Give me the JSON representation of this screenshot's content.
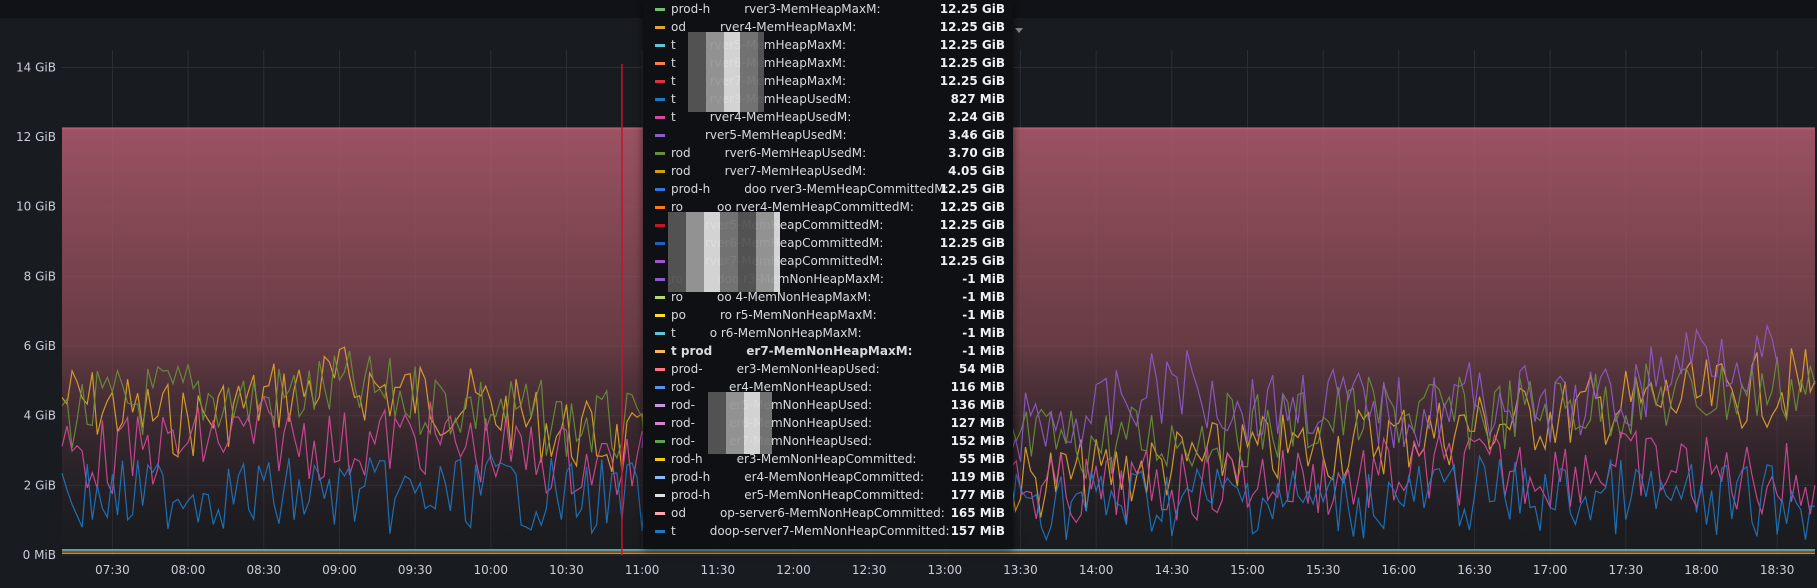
{
  "colors": {
    "background": "#181b1f",
    "grid": "#2c2f36",
    "heap_band": "#b35c6e",
    "hover_line": "#c4162a",
    "series_yellow": "#e0a52e",
    "series_green": "#6a8f3a",
    "series_pink": "#d44a9a",
    "series_blue": "#1f78c1",
    "series_purple": "#8f5bc8"
  },
  "icons": {
    "menu": "chevron-down-icon"
  },
  "chart_data": {
    "type": "line",
    "y_ticks": [
      "14 GiB",
      "12 GiB",
      "10 GiB",
      "8 GiB",
      "6 GiB",
      "4 GiB",
      "2 GiB",
      "0 MiB"
    ],
    "y_tick_values": [
      14,
      12,
      10,
      8,
      6,
      4,
      2,
      0
    ],
    "ylim": [
      0,
      14.5
    ],
    "x_ticks": [
      "07:30",
      "08:00",
      "08:30",
      "09:00",
      "09:30",
      "10:00",
      "10:30",
      "11:00",
      "11:30",
      "12:00",
      "12:30",
      "13:00",
      "13:30",
      "14:00",
      "14:30",
      "15:00",
      "15:30",
      "16:00",
      "16:30",
      "17:00",
      "17:30",
      "18:00",
      "18:30"
    ],
    "grid": true,
    "hover_time": "10:52",
    "series": [
      {
        "color": "#b35c6e",
        "fill": true,
        "x": [
          "07:10",
          "18:45"
        ],
        "values": [
          12.25,
          12.25
        ]
      },
      {
        "color": "#e0a52e",
        "x": [
          "07:10",
          "07:30",
          "08:00",
          "08:30",
          "09:00",
          "09:30",
          "10:00",
          "10:30",
          "11:00",
          "13:30",
          "14:00",
          "14:30",
          "15:00",
          "15:30",
          "16:00",
          "16:30",
          "17:00",
          "17:30",
          "18:00",
          "18:30",
          "18:45"
        ],
        "values": [
          4.5,
          4.2,
          3.8,
          4.5,
          5.0,
          4.6,
          4.2,
          3.5,
          3.0,
          2.1,
          2.3,
          2.6,
          2.9,
          3.1,
          3.4,
          3.7,
          4.0,
          4.3,
          4.5,
          4.8,
          5.0
        ]
      },
      {
        "color": "#6a8f3a",
        "x": [
          "07:10",
          "07:30",
          "08:00",
          "08:30",
          "09:00",
          "09:30",
          "10:00",
          "10:30",
          "11:00",
          "14:00",
          "14:30",
          "15:00",
          "15:30",
          "16:00",
          "16:30",
          "17:00",
          "17:30",
          "18:00",
          "18:30",
          "18:45"
        ],
        "values": [
          4.0,
          4.3,
          4.6,
          4.4,
          4.8,
          4.5,
          4.2,
          3.8,
          3.5,
          3.2,
          3.4,
          3.6,
          3.9,
          4.1,
          4.0,
          4.2,
          4.4,
          4.6,
          4.8,
          4.9
        ]
      },
      {
        "color": "#d44a9a",
        "x": [
          "07:10",
          "07:30",
          "08:00",
          "08:30",
          "09:00",
          "09:30",
          "10:00",
          "10:30",
          "11:00",
          "14:00",
          "14:30",
          "15:00",
          "15:30",
          "16:00",
          "16:30",
          "17:00",
          "17:30",
          "18:00",
          "18:30",
          "18:45"
        ],
        "values": [
          3.0,
          2.8,
          3.2,
          3.5,
          3.1,
          3.4,
          3.0,
          2.7,
          2.5,
          1.8,
          2.0,
          2.2,
          2.1,
          2.3,
          2.5,
          2.4,
          2.6,
          2.3,
          2.2,
          2.0
        ]
      },
      {
        "color": "#1f78c1",
        "x": [
          "07:10",
          "07:30",
          "08:00",
          "08:30",
          "09:00",
          "09:30",
          "10:00",
          "10:30",
          "11:00",
          "14:00",
          "14:30",
          "15:00",
          "15:30",
          "16:00",
          "16:30",
          "17:00",
          "17:30",
          "18:00",
          "18:30",
          "18:45"
        ],
        "values": [
          1.8,
          1.6,
          1.9,
          1.7,
          1.8,
          1.6,
          1.9,
          1.7,
          1.6,
          1.5,
          1.6,
          1.7,
          1.5,
          1.6,
          1.8,
          1.6,
          1.7,
          1.5,
          1.6,
          1.4
        ]
      },
      {
        "color": "#8f5bc8",
        "x": [
          "11:00",
          "13:30",
          "14:00",
          "14:30",
          "15:00",
          "15:30",
          "16:00",
          "16:30",
          "17:00",
          "17:30",
          "18:00",
          "18:30"
        ],
        "values": [
          3.8,
          3.6,
          4.0,
          5.0,
          4.2,
          4.5,
          4.0,
          4.6,
          4.2,
          4.5,
          6.0,
          5.5
        ]
      },
      {
        "color": "#ff780a",
        "x": [
          "07:10",
          "18:45"
        ],
        "values": [
          0.05,
          0.05
        ]
      },
      {
        "color": "#56a64b",
        "x": [
          "07:10",
          "18:45"
        ],
        "values": [
          0.12,
          0.12
        ]
      },
      {
        "color": "#5794f2",
        "x": [
          "07:10",
          "18:45"
        ],
        "values": [
          0.15,
          0.15
        ]
      }
    ]
  },
  "tooltip": {
    "rows": [
      {
        "color": "#73bf69",
        "name": "prod-h",
        "label": "rver3-MemHeapMaxM:",
        "value": "12.25 GiB"
      },
      {
        "color": "#e0a52e",
        "name": "od",
        "label": "rver4-MemHeapMaxM:",
        "value": "12.25 GiB"
      },
      {
        "color": "#5fc5d8",
        "name": "t",
        "label": "rver5-MemHeapMaxM:",
        "value": "12.25 GiB"
      },
      {
        "color": "#ff7e46",
        "name": "t",
        "label": "rver6-MemHeapMaxM:",
        "value": "12.25 GiB"
      },
      {
        "color": "#e02f44",
        "name": "t",
        "label": "rver7-MemHeapMaxM:",
        "value": "12.25 GiB"
      },
      {
        "color": "#1f78c1",
        "name": "t",
        "label": "rver3-MemHeapUsedM:",
        "value": "827 MiB"
      },
      {
        "color": "#d44a9a",
        "name": "t",
        "label": "rver4-MemHeapUsedM:",
        "value": "2.24 GiB"
      },
      {
        "color": "#8f5bc8",
        "name": "",
        "label": "rver5-MemHeapUsedM:",
        "value": "3.46 GiB"
      },
      {
        "color": "#6a8f3a",
        "name": "rod",
        "label": "rver6-MemHeapUsedM:",
        "value": "3.70 GiB"
      },
      {
        "color": "#cca300",
        "name": "rod",
        "label": "rver7-MemHeapUsedM:",
        "value": "4.05 GiB"
      },
      {
        "color": "#3274d9",
        "name": "prod-h",
        "label": "doo  rver3-MemHeapCommittedM:",
        "value": "12.25 GiB"
      },
      {
        "color": "#ff780a",
        "name": "ro",
        "label": "oo  rver4-MemHeapCommittedM:",
        "value": "12.25 GiB"
      },
      {
        "color": "#c4162a",
        "name": "",
        "label": "rver5-MemHeapCommittedM:",
        "value": "12.25 GiB"
      },
      {
        "color": "#1f60c4",
        "name": "",
        "label": "rver6-MemHeapCommittedM:",
        "value": "12.25 GiB"
      },
      {
        "color": "#a352cc",
        "name": "",
        "label": "rver7-MemHeapCommittedM:",
        "value": "12.25 GiB"
      },
      {
        "color": "#8f5bc8",
        "name": "ro",
        "label": "doo  r3-MemNonHeapMaxM:",
        "value": "-1 MiB"
      },
      {
        "color": "#b8d86b",
        "name": "ro",
        "label": "oo  4-MemNonHeapMaxM:",
        "value": "-1 MiB"
      },
      {
        "color": "#fade2a",
        "name": "po",
        "label": "ro  r5-MemNonHeapMaxM:",
        "value": "-1 MiB"
      },
      {
        "color": "#5fc5d8",
        "name": "t",
        "label": "o  r6-MemNonHeapMaxM:",
        "value": "-1 MiB"
      },
      {
        "color": "#ffb357",
        "name": "t  prod",
        "label": "er7-MemNonHeapMaxM:",
        "value": "-1 MiB",
        "bold": true
      },
      {
        "color": "#ff7383",
        "name": "prod-",
        "label": "er3-MemNonHeapUsed:",
        "value": "54 MiB"
      },
      {
        "color": "#5794f2",
        "name": "rod-",
        "label": "er4-MemNonHeapUsed:",
        "value": "116 MiB"
      },
      {
        "color": "#ca95e5",
        "name": "rod-",
        "label": "er5-MemNonHeapUsed:",
        "value": "136 MiB"
      },
      {
        "color": "#d683ce",
        "name": "rod-",
        "label": "er6-MemNonHeapUsed:",
        "value": "127 MiB"
      },
      {
        "color": "#56a64b",
        "name": "rod-",
        "label": "er7-MemNonHeapUsed:",
        "value": "152 MiB"
      },
      {
        "color": "#f2cc0c",
        "name": "rod-h",
        "label": "er3-MemNonHeapCommitted:",
        "value": "55 MiB"
      },
      {
        "color": "#8ab8ff",
        "name": "prod-h",
        "label": "er4-MemNonHeapCommitted:",
        "value": "119 MiB"
      },
      {
        "color": "#e0e0e0",
        "name": "prod-h",
        "label": "er5-MemNonHeapCommitted:",
        "value": "177 MiB"
      },
      {
        "color": "#ffa6b0",
        "name": "od",
        "label": "op-server6-MemNonHeapCommitted:",
        "value": "165 MiB"
      },
      {
        "color": "#1f78c1",
        "name": "t",
        "label": "doop-server7-MemNonHeapCommitted:",
        "value": "157 MiB"
      }
    ]
  }
}
